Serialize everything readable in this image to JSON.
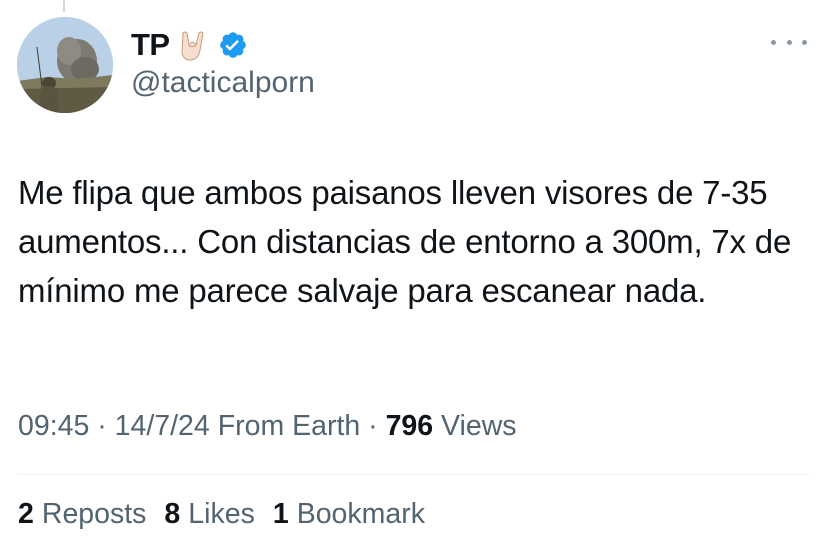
{
  "author": {
    "display_name": "TP",
    "handle": "@tacticalporn",
    "name_emoji": "rock-on-hand-emoji",
    "verified": true,
    "verified_color": "#1d9bf0"
  },
  "tweet": {
    "text": "Me flipa que ambos paisanos lleven visores de 7-35 aumentos... Con distancias de entorno a 300m, 7x de mínimo me parece salvaje para escanear nada."
  },
  "meta": {
    "time": "09:45",
    "separator": "·",
    "date": "14/7/24",
    "source": "From Earth",
    "views_count": "796",
    "views_label": "Views"
  },
  "stats": {
    "reposts_count": "2",
    "reposts_label": "Reposts",
    "likes_count": "8",
    "likes_label": "Likes",
    "bookmarks_count": "1",
    "bookmarks_label": "Bookmark"
  },
  "colors": {
    "text_primary": "#0f1419",
    "text_secondary": "#536471",
    "divider": "#eff3f4"
  }
}
